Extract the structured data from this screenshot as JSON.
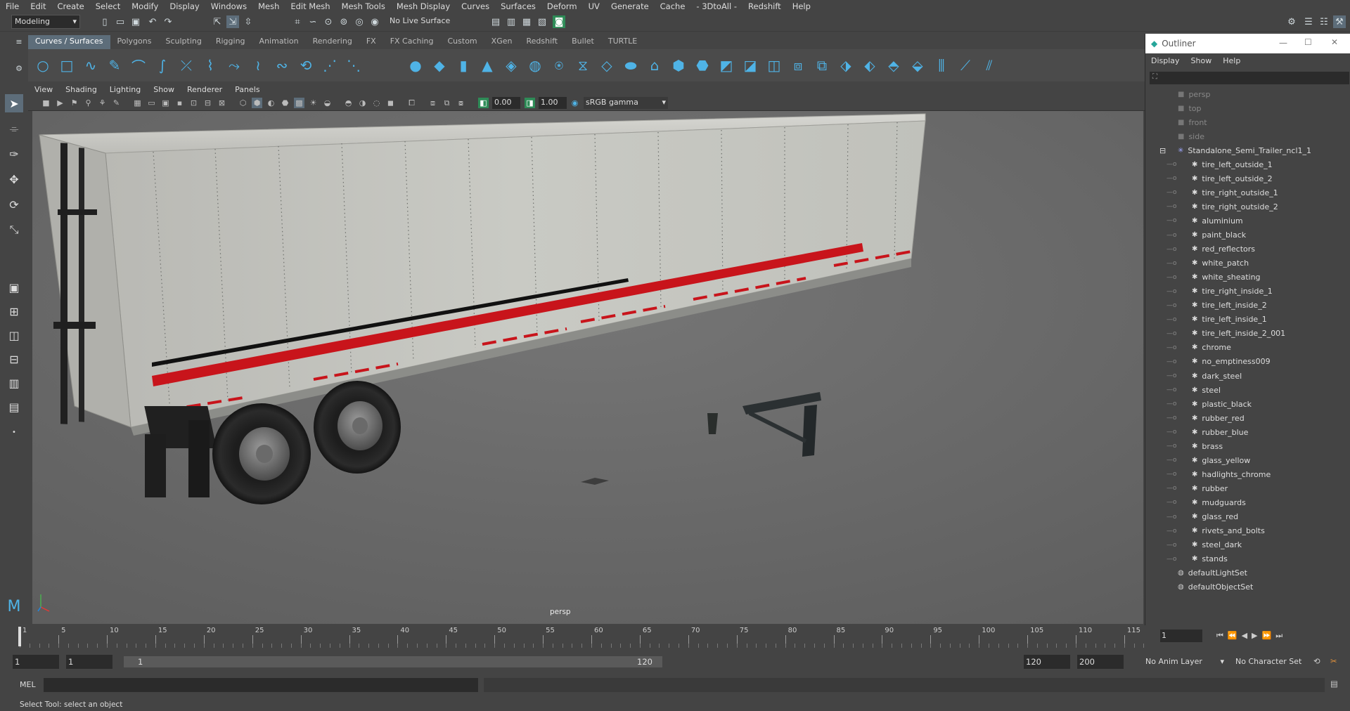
{
  "menubar": [
    "File",
    "Edit",
    "Create",
    "Select",
    "Modify",
    "Display",
    "Windows",
    "Mesh",
    "Edit Mesh",
    "Mesh Tools",
    "Mesh Display",
    "Curves",
    "Surfaces",
    "Deform",
    "UV",
    "Generate",
    "Cache",
    "- 3DtoAll -",
    "Redshift",
    "Help"
  ],
  "status": {
    "mode": "Modeling",
    "live_surface": "No Live Surface"
  },
  "shelf_tabs": [
    "Curves / Surfaces",
    "Polygons",
    "Sculpting",
    "Rigging",
    "Animation",
    "Rendering",
    "FX",
    "FX Caching",
    "Custom",
    "XGen",
    "Redshift",
    "Bullet",
    "TURTLE"
  ],
  "viewport_menu": [
    "View",
    "Shading",
    "Lighting",
    "Show",
    "Renderer",
    "Panels"
  ],
  "viewport_toolbar": {
    "exposure": "0.00",
    "gamma": "1.00",
    "color_space": "sRGB gamma"
  },
  "viewport_label": "persp",
  "outliner": {
    "title": "Outliner",
    "menu": [
      "Display",
      "Show",
      "Help"
    ],
    "cameras": [
      "persp",
      "top",
      "front",
      "side"
    ],
    "root": "Standalone_Semi_Trailer_ncl1_1",
    "children": [
      "tire_left_outside_1",
      "tire_left_outside_2",
      "tire_right_outside_1",
      "tire_right_outside_2",
      "aluminium",
      "paint_black",
      "red_reflectors",
      "white_patch",
      "white_sheating",
      "tire_right_inside_1",
      "tire_left_inside_2",
      "tire_left_inside_1",
      "tire_left_inside_2_001",
      "chrome",
      "no_emptiness009",
      "dark_steel",
      "steel",
      "plastic_black",
      "rubber_red",
      "rubber_blue",
      "brass",
      "glass_yellow",
      "hadlights_chrome",
      "rubber",
      "mudguards",
      "glass_red",
      "rivets_and_bolts",
      "steel_dark",
      "stands"
    ],
    "sets": [
      "defaultLightSet",
      "defaultObjectSet"
    ]
  },
  "timeline": {
    "ticks": [
      "1",
      "5",
      "10",
      "15",
      "20",
      "25",
      "30",
      "35",
      "40",
      "45",
      "50",
      "55",
      "60",
      "65",
      "70",
      "75",
      "80",
      "85",
      "90",
      "95",
      "100",
      "105",
      "110",
      "115"
    ],
    "current": "1"
  },
  "range": {
    "start": "1",
    "playback_start": "1",
    "slider_start": "1",
    "slider_end": "120",
    "playback_end": "120",
    "end": "200",
    "anim_layer": "No Anim Layer",
    "char_set": "No Character Set"
  },
  "cmd": {
    "label": "MEL"
  },
  "help_text": "Select Tool: select an object",
  "colors": {
    "accent": "#4fb3e6",
    "stripe_red": "#c8141b",
    "viewport_bg": "#6a6a6a"
  }
}
